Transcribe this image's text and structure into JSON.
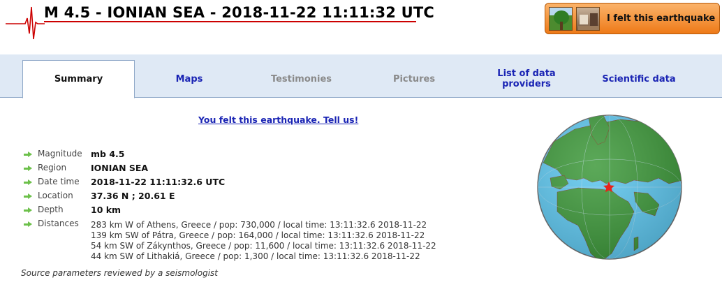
{
  "header": {
    "title": "M 4.5 - IONIAN SEA - 2018-11-22 11:11:32 UTC",
    "felt_button_label": "I felt this earthquake"
  },
  "tabs": [
    {
      "label": "Summary",
      "state": "active"
    },
    {
      "label": "Maps",
      "state": "normal"
    },
    {
      "label": "Testimonies",
      "state": "disabled"
    },
    {
      "label": "Pictures",
      "state": "disabled"
    },
    {
      "label": "List of data providers",
      "state": "normal"
    },
    {
      "label": "Scientific data",
      "state": "normal"
    }
  ],
  "felt_link": "You felt this earthquake. Tell us!",
  "details": {
    "magnitude": {
      "label": "Magnitude",
      "value": "mb 4.5"
    },
    "region": {
      "label": "Region",
      "value": "IONIAN SEA"
    },
    "datetime": {
      "label": "Date time",
      "value": "2018-11-22 11:11:32.6 UTC"
    },
    "location": {
      "label": "Location",
      "value": "37.36 N ; 20.61 E"
    },
    "depth": {
      "label": "Depth",
      "value": "10 km"
    },
    "distances": {
      "label": "Distances",
      "items": [
        "283 km W of Athens, Greece / pop: 730,000 / local time: 13:11:32.6 2018-11-22",
        "139 km SW of Pátra, Greece / pop: 164,000 / local time: 13:11:32.6 2018-11-22",
        "54 km SW of Zákynthos, Greece / pop: 11,600 / local time: 13:11:32.6 2018-11-22",
        "44 km SW of Lithakiá, Greece / pop: 1,300 / local time: 13:11:32.6 2018-11-22"
      ]
    }
  },
  "source_note": "Source parameters reviewed by a seismologist",
  "colors": {
    "accent_red": "#cc0000",
    "link_blue": "#1a24b4",
    "tabbar_bg": "#dfe9f5",
    "button_orange": "#ee7a18",
    "arrow_green": "#6cc04a",
    "ocean": "#5fc8f0",
    "land": "#3f9a3c",
    "epicenter_star": "#e8231b"
  }
}
